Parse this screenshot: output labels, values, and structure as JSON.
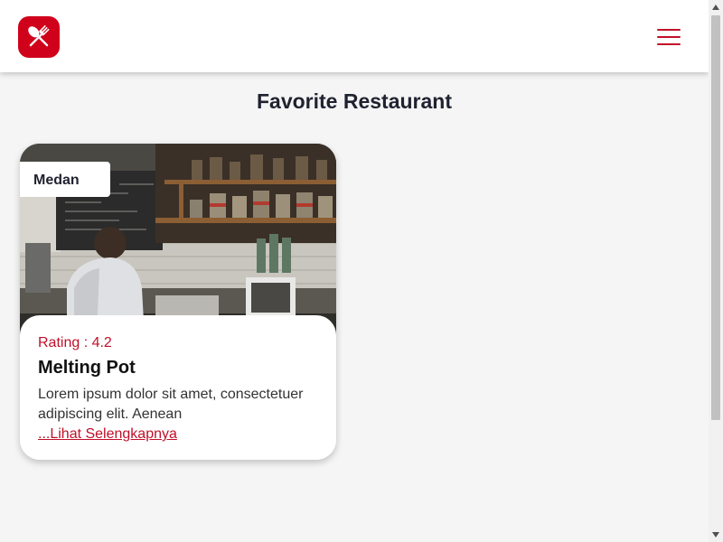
{
  "header": {
    "logo_icon": "utensils-logo-icon",
    "menu_icon": "hamburger-menu-icon",
    "brand_color": "#d0021b"
  },
  "main": {
    "title": "Favorite Restaurant",
    "restaurants": [
      {
        "city": "Medan",
        "rating": "Rating : 4.2",
        "name": "Melting Pot",
        "description": "Lorem ipsum dolor sit amet, consectetuer adipiscing elit. Aenean",
        "link_text": "...Lihat Selengkapnya",
        "image_icon": "restaurant-photo"
      }
    ]
  },
  "colors": {
    "accent": "#c0102a",
    "background": "#f5f5f5",
    "card": "#ffffff"
  }
}
